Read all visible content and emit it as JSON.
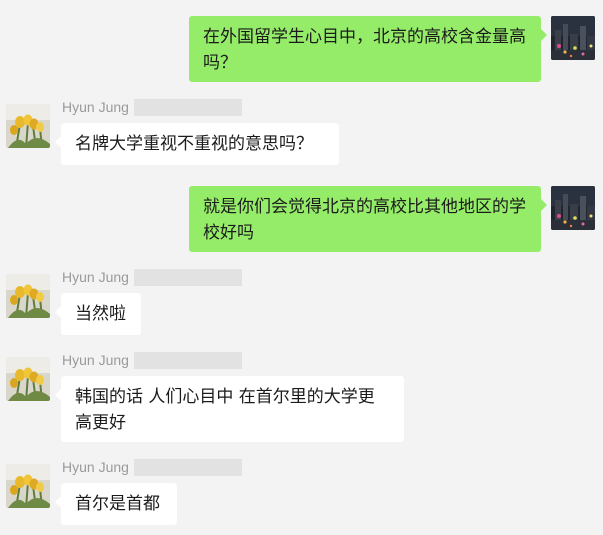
{
  "conversation": {
    "messages": [
      {
        "sender": "me",
        "text": "在外国留学生心目中，北京的高校含金量高吗？"
      },
      {
        "sender": "Hyun Jung",
        "text": "名牌大学重视不重视的意思吗？"
      },
      {
        "sender": "me",
        "text": "就是你们会觉得北京的高校比其他地区的学校好吗"
      },
      {
        "sender": "Hyun Jung",
        "text": "当然啦"
      },
      {
        "sender": "Hyun Jung",
        "text": "韩国的话 人们心目中 在首尔里的大学更高更好"
      },
      {
        "sender": "Hyun Jung",
        "text": "首尔是首都"
      }
    ]
  },
  "avatars": {
    "me": "city-night-avatar-icon",
    "contact": "yellow-tulips-avatar-icon"
  },
  "colors": {
    "background": "#f3f3f3",
    "outgoing_bubble": "#95ec69",
    "incoming_bubble": "#ffffff",
    "name_text": "#9a9a9a"
  }
}
